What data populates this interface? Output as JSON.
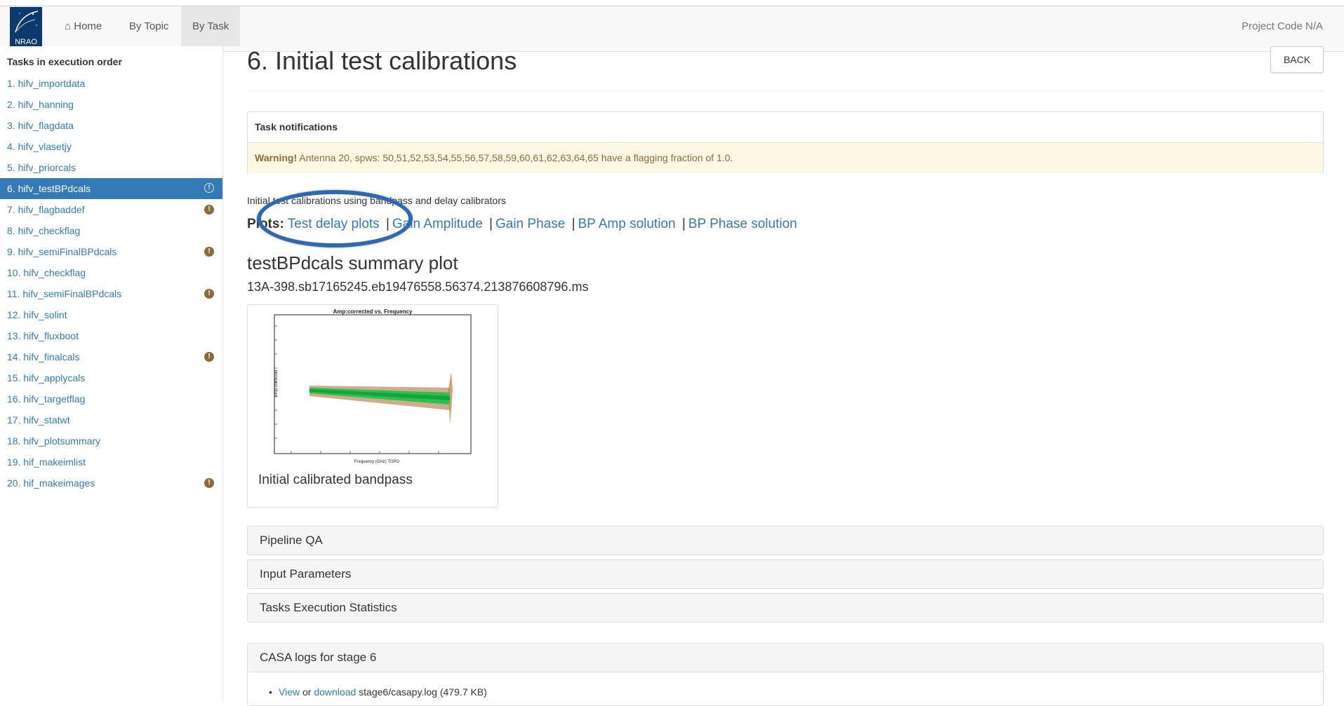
{
  "navbar": {
    "logo_text": "NRAO",
    "home_label": "Home",
    "by_topic_label": "By Topic",
    "by_task_label": "By Task",
    "project_code": "Project Code N/A"
  },
  "sidebar": {
    "title": "Tasks in execution order",
    "items": [
      {
        "label": "1. hifv_importdata",
        "warning": false,
        "active": false
      },
      {
        "label": "2. hifv_hanning",
        "warning": false,
        "active": false
      },
      {
        "label": "3. hifv_flagdata",
        "warning": false,
        "active": false
      },
      {
        "label": "4. hifv_vlasetjy",
        "warning": false,
        "active": false
      },
      {
        "label": "5. hifv_priorcals",
        "warning": false,
        "active": false
      },
      {
        "label": "6. hifv_testBPdcals",
        "warning": true,
        "active": true
      },
      {
        "label": "7. hifv_flagbaddef",
        "warning": true,
        "active": false
      },
      {
        "label": "8. hifv_checkflag",
        "warning": false,
        "active": false
      },
      {
        "label": "9. hifv_semiFinalBPdcals",
        "warning": true,
        "active": false
      },
      {
        "label": "10. hifv_checkflag",
        "warning": false,
        "active": false
      },
      {
        "label": "11. hifv_semiFinalBPdcals",
        "warning": true,
        "active": false
      },
      {
        "label": "12. hifv_solint",
        "warning": false,
        "active": false
      },
      {
        "label": "13. hifv_fluxboot",
        "warning": false,
        "active": false
      },
      {
        "label": "14. hifv_finalcals",
        "warning": true,
        "active": false
      },
      {
        "label": "15. hifv_applycals",
        "warning": false,
        "active": false
      },
      {
        "label": "16. hifv_targetflag",
        "warning": false,
        "active": false
      },
      {
        "label": "17. hifv_statwt",
        "warning": false,
        "active": false
      },
      {
        "label": "18. hifv_plotsummary",
        "warning": false,
        "active": false
      },
      {
        "label": "19. hif_makeimlist",
        "warning": false,
        "active": false
      },
      {
        "label": "20. hif_makeimages",
        "warning": true,
        "active": false
      }
    ]
  },
  "main": {
    "title": "6. Initial test calibrations",
    "back_label": "BACK",
    "notifications": {
      "heading": "Task notifications",
      "warning_label": "Warning!",
      "warning_text": " Antenna 20, spws: 50,51,52,53,54,55,56,57,58,59,60,61,62,63,64,65 have a flagging fraction of 1.0."
    },
    "description": "Initial test calibrations using bandpass and delay calibrators",
    "plots": {
      "label": "Plots:",
      "separator": "|",
      "links": [
        "Test delay plots",
        "Gain Amplitude",
        "Gain Phase",
        "BP Amp solution",
        "BP Phase solution"
      ]
    },
    "summary_title": "testBPdcals summary plot",
    "ms_name": "13A-398.sb17165245.eb19476558.56374.213876608796.ms",
    "thumbnail": {
      "plot_title": "Amp:corrected vs. Frequency",
      "xlabel": "Frequency (GHz) TOPO",
      "ylabel": "Amp:corrected",
      "caption": "Initial calibrated bandpass"
    },
    "sections": [
      "Pipeline QA",
      "Input Parameters",
      "Tasks Execution Statistics"
    ],
    "casa_logs": {
      "heading": "CASA logs for stage 6",
      "view_label": "View",
      "or_text": " or ",
      "download_label": "download",
      "file_text": " stage6/casapy.log (479.7 KB)"
    }
  }
}
